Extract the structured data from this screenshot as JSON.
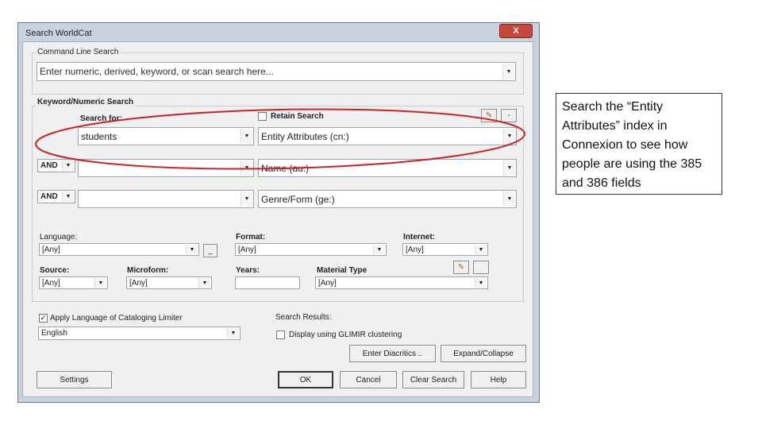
{
  "window": {
    "title": "Search WorldCat",
    "close_label": "X"
  },
  "command_line": {
    "group_label": "Command Line Search",
    "placeholder": "Enter numeric, derived, keyword, or scan search here..."
  },
  "keyword": {
    "group_label": "Keyword/Numeric Search",
    "search_for_label": "Search for:",
    "retain_search_label": "Retain Search",
    "minus_label": "-",
    "rows": [
      {
        "operator": "",
        "term": "students",
        "index": "Entity Attributes (cn:)"
      },
      {
        "operator": "AND",
        "term": "",
        "index": "Name (au:)"
      },
      {
        "operator": "AND",
        "term": "",
        "index": "Genre/Form (ge:)"
      }
    ]
  },
  "limits": {
    "language_label": "Language:",
    "language_value": "[Any]",
    "language_btn": "_",
    "format_label": "Format:",
    "format_value": "[Any]",
    "internet_label": "Internet:",
    "internet_value": "[Any]",
    "source_label": "Source:",
    "source_value": "[Any]",
    "microform_label": "Microform:",
    "microform_value": "[Any]",
    "years_label": "Years:",
    "years_value": "",
    "material_label": "Material Type",
    "material_value": "[Any]"
  },
  "cataloging": {
    "apply_label": "Apply Language of Cataloging Limiter",
    "apply_checked": true,
    "language_value": "English"
  },
  "results": {
    "label": "Search Results:",
    "glimir_label": "Display using GLIMIR clustering",
    "glimir_checked": false
  },
  "buttons": {
    "diacritics": "Enter Diacritics ..",
    "expand": "Expand/Collapse",
    "settings": "Settings",
    "ok": "OK",
    "cancel": "Cancel",
    "clear": "Clear Search",
    "help": "Help"
  },
  "annotation": {
    "text": "Search the “Entity Attributes” index in Connexion to see how people are using the 385 and 386 fields",
    "ellipse_color": "#cc2222"
  }
}
